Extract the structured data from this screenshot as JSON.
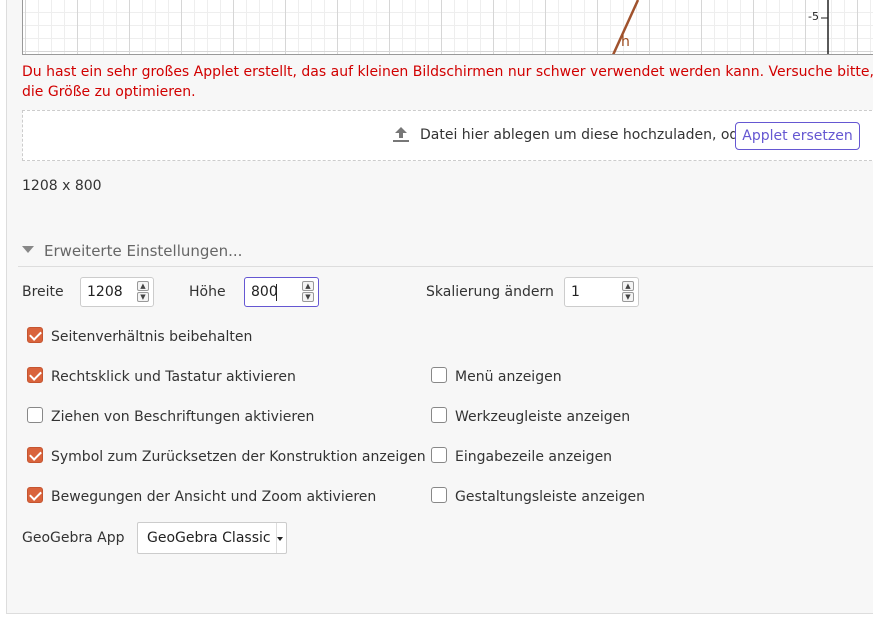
{
  "applet": {
    "axis_tick_label": "-5",
    "curve_label": "h",
    "curve_color": "#a0522d"
  },
  "warning": {
    "text": "Du hast ein sehr großes Applet erstellt, das auf kleinen Bildschirmen nur schwer verwendet werden kann. Versuche bitte, die Größe zu optimieren."
  },
  "upload": {
    "icon": "upload-icon",
    "drop_text": "Datei hier ablegen um diese hochzuladen, oder",
    "replace_button": "Applet ersetzen"
  },
  "dimensions_text": "1208 x 800",
  "advanced": {
    "header": "Erweiterte Einstellungen...",
    "width_label": "Breite",
    "width_value": "1208",
    "height_label": "Höhe",
    "height_value": "800",
    "scale_label": "Skalierung ändern",
    "scale_value": "1",
    "options_left": [
      {
        "label": "Rechtsklick und Tastatur aktivieren",
        "checked": true
      },
      {
        "label": "Ziehen von Beschriftungen aktivieren",
        "checked": false
      },
      {
        "label": "Symbol zum Zurücksetzen der Konstruktion anzeigen",
        "checked": true
      },
      {
        "label": "Bewegungen der Ansicht und Zoom aktivieren",
        "checked": true
      }
    ],
    "keep_ratio": {
      "label": "Seitenverhältnis beibehalten",
      "checked": true
    },
    "options_right": [
      {
        "label": "Menü anzeigen",
        "checked": false
      },
      {
        "label": "Werkzeugleiste anzeigen",
        "checked": false
      },
      {
        "label": "Eingabezeile anzeigen",
        "checked": false
      },
      {
        "label": "Gestaltungsleiste anzeigen",
        "checked": false
      }
    ],
    "app_label": "GeoGebra App",
    "app_value": "GeoGebra Classic"
  },
  "colors": {
    "accent": "#6557d2",
    "checkbox": "#d9633c",
    "warning": "#d10000"
  }
}
